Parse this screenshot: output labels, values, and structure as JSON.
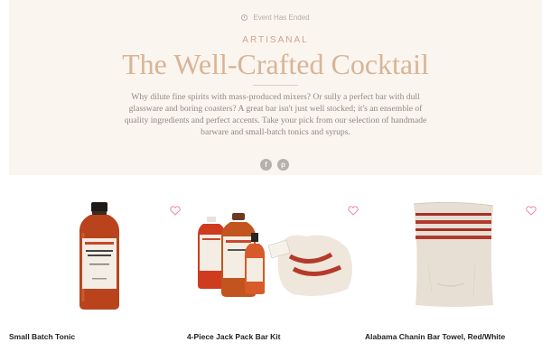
{
  "hero": {
    "event_status": "Event Has Ended",
    "eyebrow": "ARTISANAL",
    "title": "The Well-Crafted Cocktail",
    "description": "Why dilute fine spirits with mass-produced mixers? Or sully a perfect bar with dull glassware and boring coasters? A great bar isn't just well stocked; it's an ensemble of quality ingredients and perfect accents. Take your pick from our selection of handmade barware and small-batch tonics and syrups.",
    "share": {
      "facebook_glyph": "f",
      "pinterest_glyph": "p"
    }
  },
  "products": [
    {
      "name": "Small Batch Tonic",
      "icon": "bottle"
    },
    {
      "name": "4-Piece Jack Pack Bar Kit",
      "icon": "bottle-kit"
    },
    {
      "name": "Alabama Chanin Bar Towel, Red/White",
      "icon": "towel"
    }
  ],
  "colors": {
    "hero_bg": "#fbf5f0",
    "title": "#d7b596",
    "heart": "#e78aa0",
    "amber": "#b8431c"
  }
}
